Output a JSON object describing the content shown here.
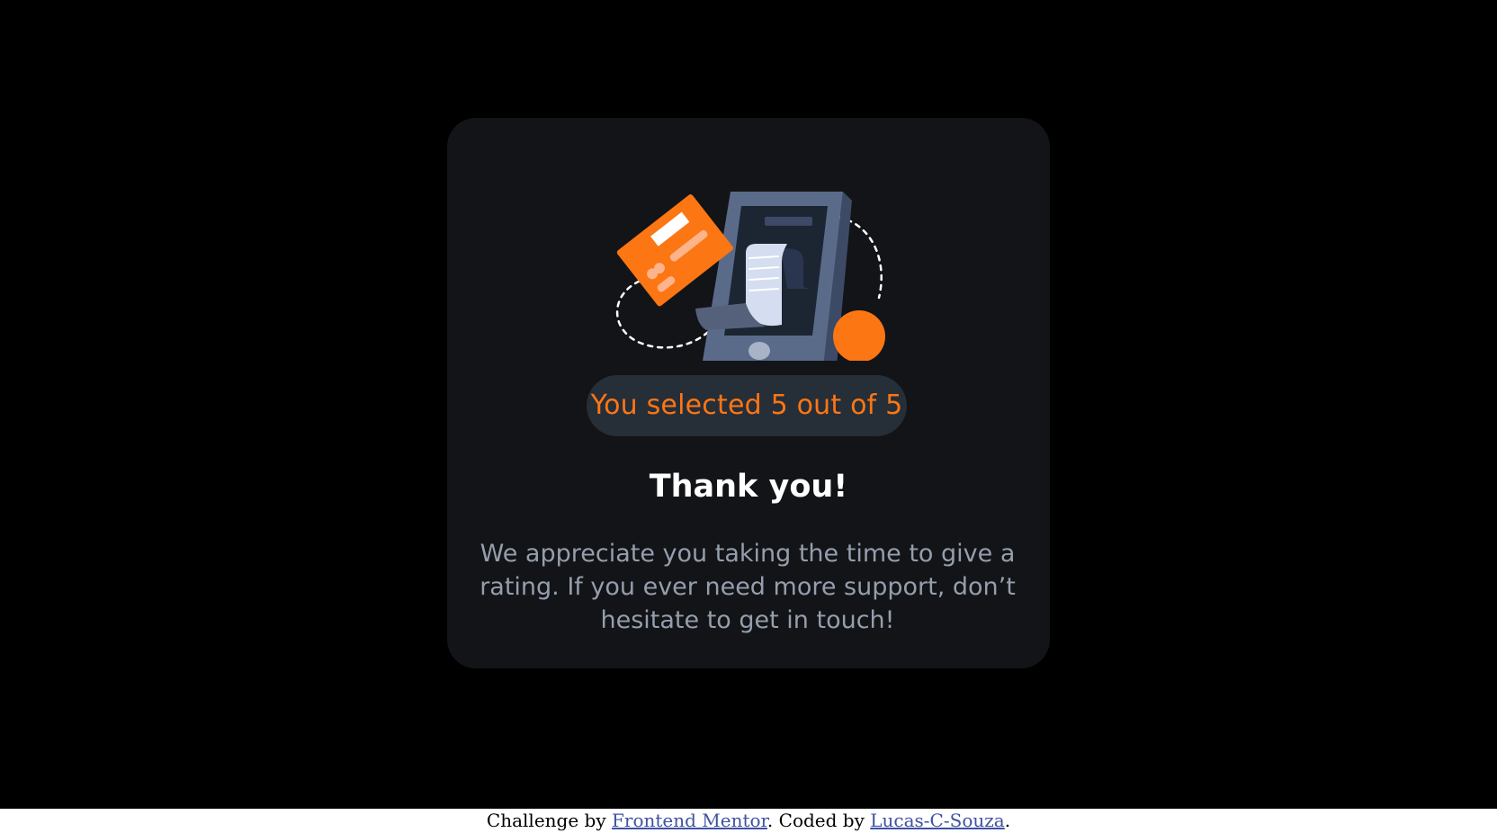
{
  "colors": {
    "page_background": "#000000",
    "card_background": "#121417",
    "badge_background": "#262E38",
    "accent_orange": "#FC7614",
    "heading": "#FFFFFF",
    "body_text": "#959EAC",
    "link": "#3E52A3"
  },
  "illustration": {
    "icon": "phone-receipt-card-illustration"
  },
  "rating": {
    "selection_text": "You selected 5 out of 5",
    "selected": 5,
    "max": 5
  },
  "title": "Thank you!",
  "message": "We appreciate you taking the time to give a rating. If you ever need more support, don’t hesitate to get in touch!",
  "attribution": {
    "prefix": "Challenge by ",
    "link1": "Frontend Mentor",
    "middle": ". Coded by ",
    "link2": "Lucas-C-Souza",
    "suffix": "."
  }
}
